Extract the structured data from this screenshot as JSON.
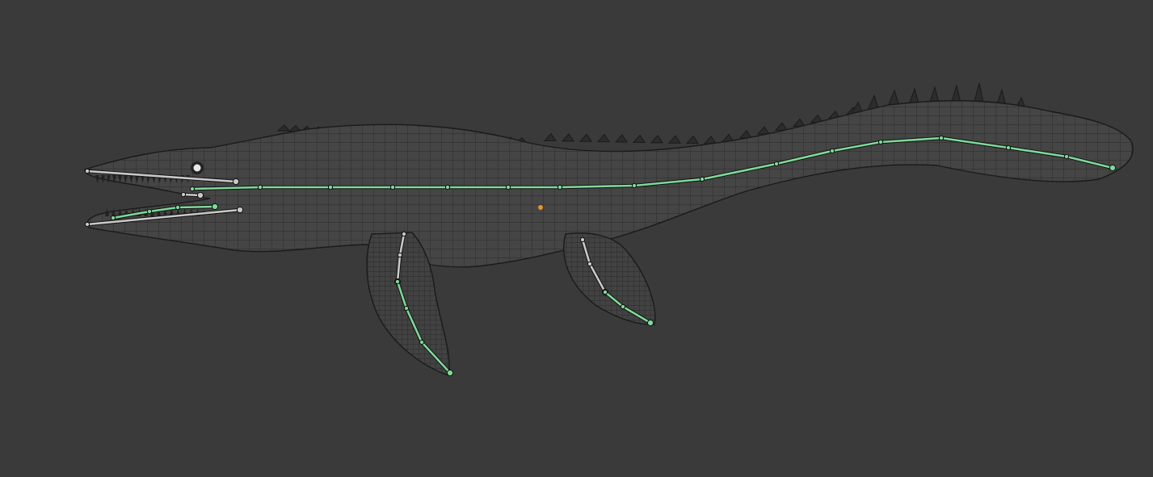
{
  "viewport": {
    "background_color": "#3a3a3a",
    "mesh_color": "#1e1e1e",
    "body_fill_color": "#444444",
    "selected_bone_color": "#7fd99a",
    "unselected_bone_color": "#c9c9c9",
    "origin_color": "#e8902c",
    "eye_color": "#e8e8e8",
    "object": {
      "type": "wireframe mesh with armature",
      "bones": {
        "spine": {
          "selected": true
        },
        "upper_jaw": {
          "selected": false
        },
        "lower_jaw": {
          "selected": true
        },
        "front_flipper": {
          "selected": true
        },
        "rear_flipper": {
          "selected": true
        }
      },
      "spikes": {
        "icon": "dorsal-spike-icon"
      }
    }
  }
}
